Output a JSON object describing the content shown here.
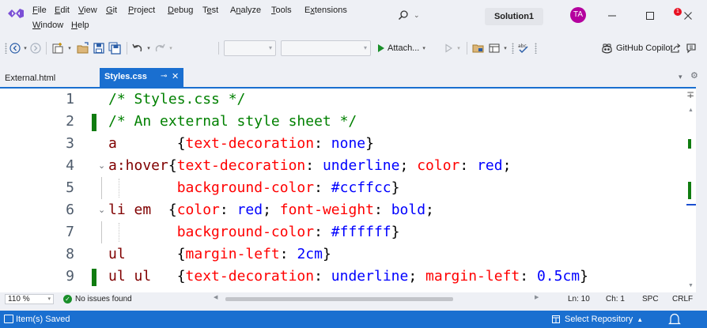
{
  "menu": {
    "items": [
      "File",
      "Edit",
      "View",
      "Git",
      "Project",
      "Debug",
      "Test",
      "Analyze",
      "Tools",
      "Extensions",
      "Window",
      "Help"
    ]
  },
  "title_bar": {
    "solution_name": "Solution1",
    "user_initials": "TA"
  },
  "toolbar": {
    "attach_label": "Attach...",
    "copilot_label": "GitHub Copilot"
  },
  "tabs": [
    {
      "label": "External.html",
      "active": false
    },
    {
      "label": "Styles.css",
      "active": true,
      "pinned": false
    }
  ],
  "editor": {
    "lines": [
      {
        "n": "1",
        "changed": false,
        "fold": "",
        "tokens": [
          {
            "t": "/* Styles.css */",
            "c": "comment"
          }
        ]
      },
      {
        "n": "2",
        "changed": true,
        "fold": "",
        "tokens": [
          {
            "t": "/* An external style sheet */",
            "c": "comment"
          }
        ]
      },
      {
        "n": "3",
        "changed": false,
        "fold": "",
        "tokens": [
          {
            "t": "a",
            "c": "sel"
          },
          {
            "t": "       {",
            "c": "punc"
          },
          {
            "t": "text-decoration",
            "c": "prop"
          },
          {
            "t": ": ",
            "c": "punc"
          },
          {
            "t": "none",
            "c": "val"
          },
          {
            "t": "}",
            "c": "punc"
          }
        ]
      },
      {
        "n": "4",
        "changed": false,
        "fold": "open",
        "tokens": [
          {
            "t": "a:hover",
            "c": "sel"
          },
          {
            "t": "{",
            "c": "punc"
          },
          {
            "t": "text-decoration",
            "c": "prop"
          },
          {
            "t": ": ",
            "c": "punc"
          },
          {
            "t": "underline",
            "c": "val"
          },
          {
            "t": "; ",
            "c": "punc"
          },
          {
            "t": "color",
            "c": "prop"
          },
          {
            "t": ": ",
            "c": "punc"
          },
          {
            "t": "red",
            "c": "val"
          },
          {
            "t": ";",
            "c": "punc"
          }
        ]
      },
      {
        "n": "5",
        "changed": false,
        "fold": "body",
        "tokens": [
          {
            "t": "        ",
            "c": "punc"
          },
          {
            "t": "background-color",
            "c": "prop"
          },
          {
            "t": ": ",
            "c": "punc"
          },
          {
            "t": "#ccffcc",
            "c": "val"
          },
          {
            "t": "}",
            "c": "punc"
          }
        ]
      },
      {
        "n": "6",
        "changed": false,
        "fold": "open",
        "tokens": [
          {
            "t": "li em",
            "c": "sel"
          },
          {
            "t": "  {",
            "c": "punc"
          },
          {
            "t": "color",
            "c": "prop"
          },
          {
            "t": ": ",
            "c": "punc"
          },
          {
            "t": "red",
            "c": "val"
          },
          {
            "t": "; ",
            "c": "punc"
          },
          {
            "t": "font-weight",
            "c": "prop"
          },
          {
            "t": ": ",
            "c": "punc"
          },
          {
            "t": "bold",
            "c": "val"
          },
          {
            "t": ";",
            "c": "punc"
          }
        ]
      },
      {
        "n": "7",
        "changed": false,
        "fold": "body",
        "tokens": [
          {
            "t": "        ",
            "c": "punc"
          },
          {
            "t": "background-color",
            "c": "prop"
          },
          {
            "t": ": ",
            "c": "punc"
          },
          {
            "t": "#ffffff",
            "c": "val"
          },
          {
            "t": "}",
            "c": "punc"
          }
        ]
      },
      {
        "n": "8",
        "changed": false,
        "fold": "",
        "tokens": [
          {
            "t": "ul",
            "c": "sel"
          },
          {
            "t": "      {",
            "c": "punc"
          },
          {
            "t": "margin-left",
            "c": "prop"
          },
          {
            "t": ": ",
            "c": "punc"
          },
          {
            "t": "2cm",
            "c": "val"
          },
          {
            "t": "}",
            "c": "punc"
          }
        ]
      },
      {
        "n": "9",
        "changed": true,
        "fold": "",
        "tokens": [
          {
            "t": "ul ul",
            "c": "sel"
          },
          {
            "t": "   {",
            "c": "punc"
          },
          {
            "t": "text-decoration",
            "c": "prop"
          },
          {
            "t": ": ",
            "c": "punc"
          },
          {
            "t": "underline",
            "c": "val"
          },
          {
            "t": "; ",
            "c": "punc"
          },
          {
            "t": "margin-left",
            "c": "prop"
          },
          {
            "t": ": ",
            "c": "punc"
          },
          {
            "t": "0.5cm",
            "c": "val"
          },
          {
            "t": "}",
            "c": "punc"
          }
        ]
      }
    ]
  },
  "editor_status": {
    "zoom": "110 %",
    "issues": "No issues found",
    "ln": "Ln: 10",
    "ch": "Ch: 1",
    "spc": "SPC",
    "eol": "CRLF"
  },
  "status_bar": {
    "message": "Item(s) Saved",
    "repo_label": "Select Repository",
    "notification_count": "1"
  },
  "colors": {
    "accent": "#1a6fd0",
    "change_bar": "#107c10",
    "comment": "#008000",
    "selector": "#800000",
    "property": "#ff0000",
    "value": "#0000ff"
  }
}
